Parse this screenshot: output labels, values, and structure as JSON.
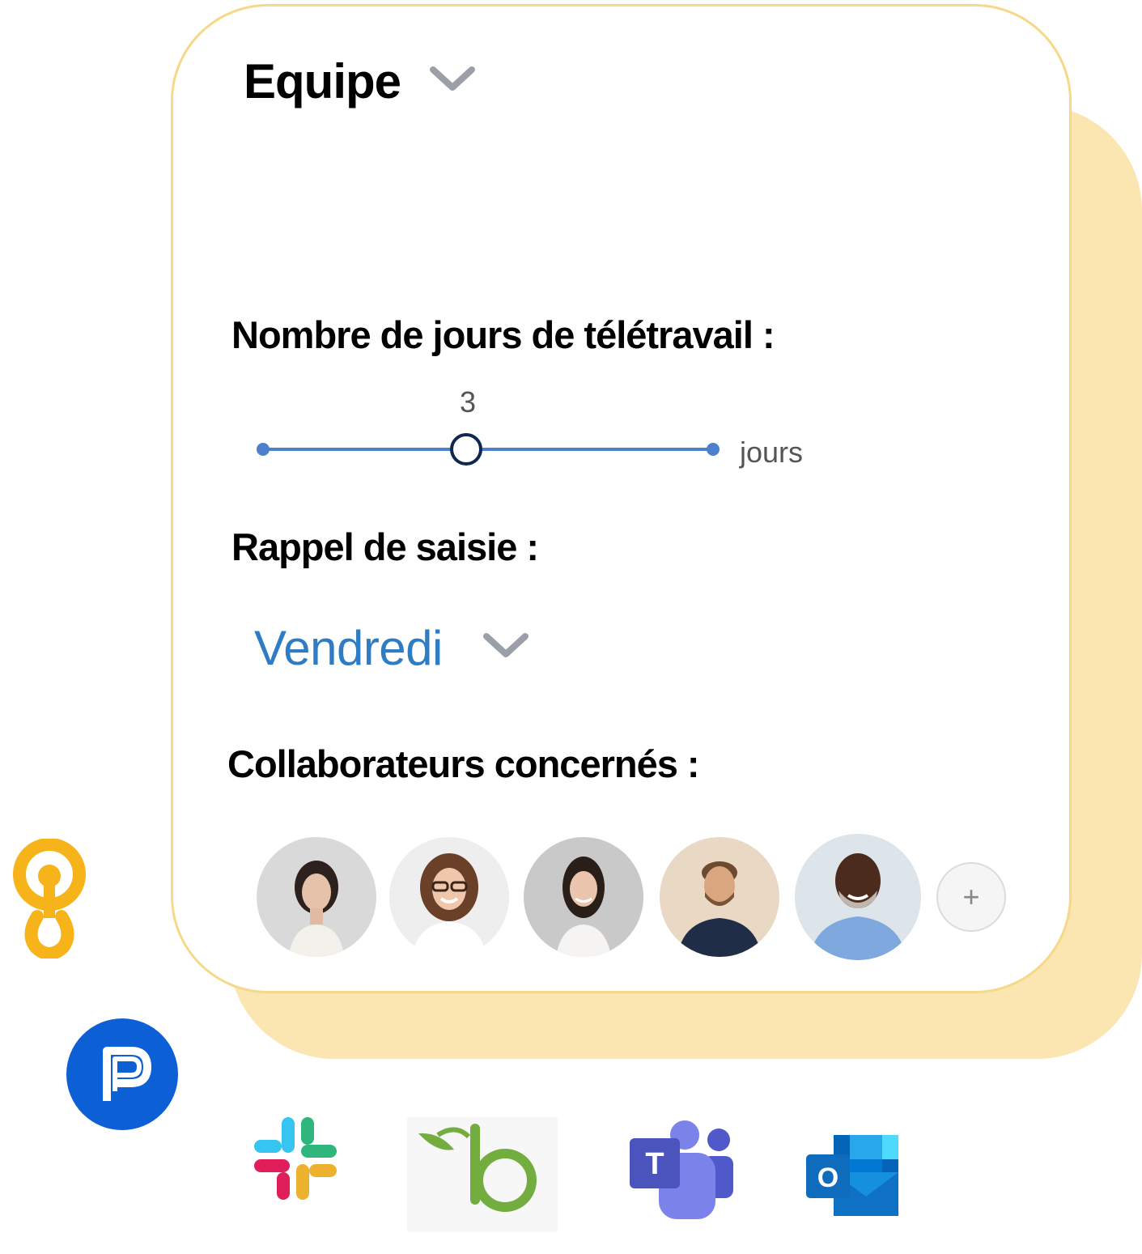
{
  "team": {
    "label": "Equipe"
  },
  "remote_days": {
    "title": "Nombre de jours de télétravail :",
    "value": "3",
    "unit": "jours",
    "position_fraction": 0.45
  },
  "reminder": {
    "title": "Rappel de saisie :",
    "selected_day": "Vendredi"
  },
  "collaborators": {
    "title": "Collaborateurs concernés :",
    "add_label": "+",
    "avatars": [
      {
        "name": "avatar-1"
      },
      {
        "name": "avatar-2"
      },
      {
        "name": "avatar-3"
      },
      {
        "name": "avatar-4"
      },
      {
        "name": "avatar-5"
      }
    ]
  },
  "integrations": {
    "teams_letter": "T",
    "outlook_letter": "O",
    "icons": [
      "orange-integration-icon",
      "p-logo-icon",
      "slack-icon",
      "bamboohr-icon",
      "microsoft-teams-icon",
      "outlook-icon"
    ]
  },
  "colors": {
    "accent_yellow": "#fbe5b1",
    "border_yellow": "#f5d88a",
    "slider_blue": "#4d7fcf",
    "thumb_navy": "#0e2650",
    "link_blue": "#2e7cc4"
  }
}
